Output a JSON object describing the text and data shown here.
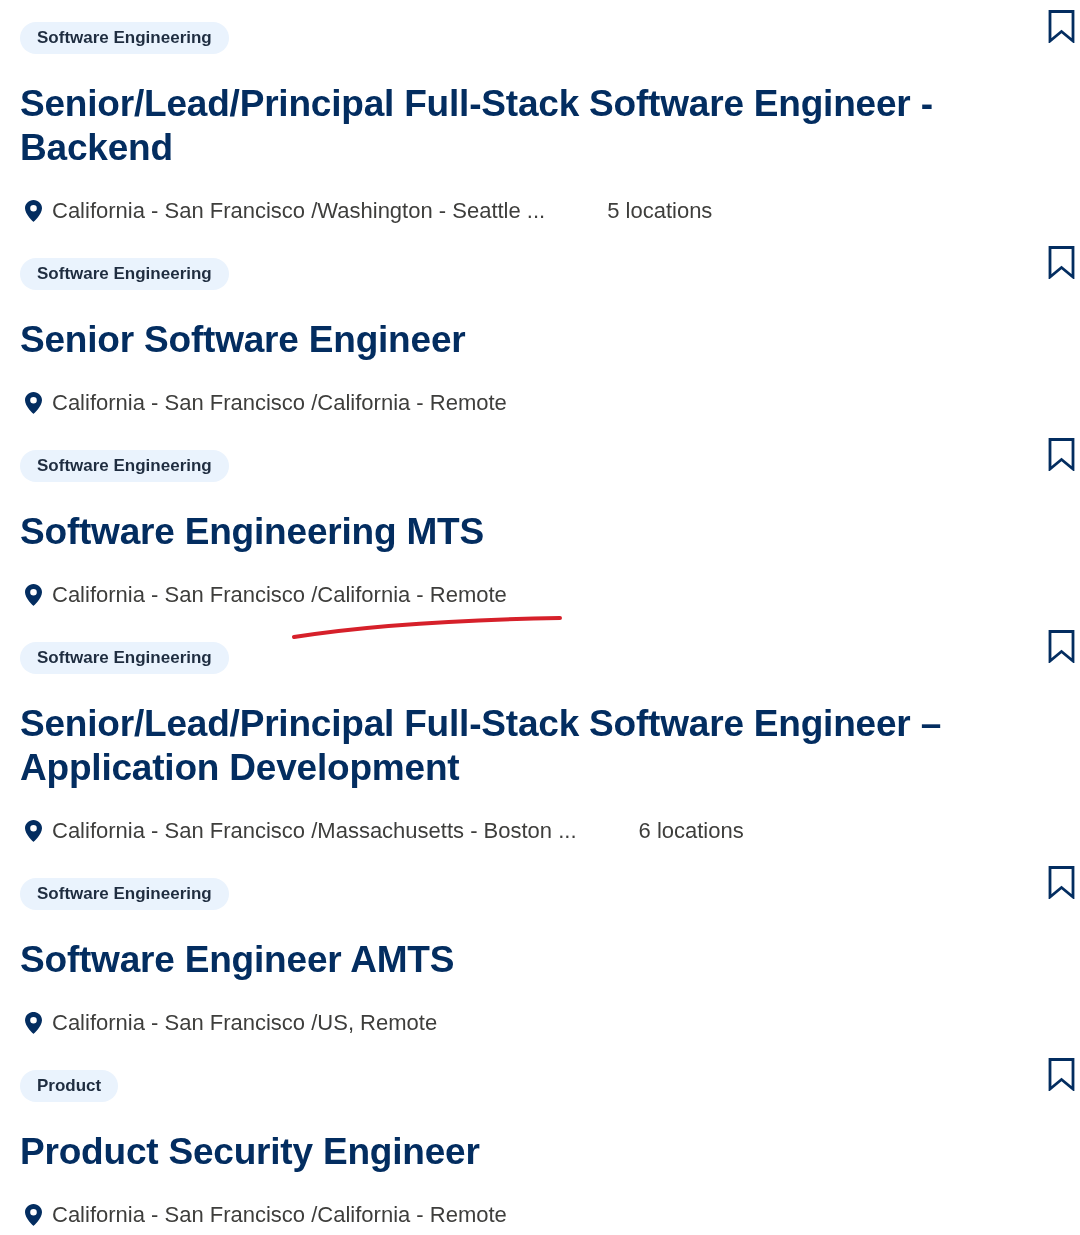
{
  "jobs": [
    {
      "category": "Software Engineering",
      "title": "Senior/Lead/Principal Full-Stack Software Engineer - Backend",
      "location": "California - San Francisco /Washington - Seattle ...",
      "location_count": "5 locations",
      "saved": false,
      "marked": false
    },
    {
      "category": "Software Engineering",
      "title": "Senior Software Engineer",
      "location": "California - San Francisco /California - Remote",
      "saved": false,
      "marked": false
    },
    {
      "category": "Software Engineering",
      "title": "Software Engineering MTS",
      "location": "California - San Francisco /California - Remote",
      "saved": false,
      "marked": true
    },
    {
      "category": "Software Engineering",
      "title": "Senior/Lead/Principal Full-Stack Software Engineer – Application Development",
      "location": "California - San Francisco /Massachusetts - Boston ...",
      "location_count": "6 locations",
      "saved": false,
      "marked": false
    },
    {
      "category": "Software Engineering",
      "title": "Software Engineer AMTS",
      "location": "California - San Francisco /US, Remote",
      "saved": false,
      "marked": false
    },
    {
      "category": "Product",
      "title": "Product Security Engineer",
      "location": "California - San Francisco /California - Remote",
      "saved": false,
      "marked": false
    }
  ]
}
